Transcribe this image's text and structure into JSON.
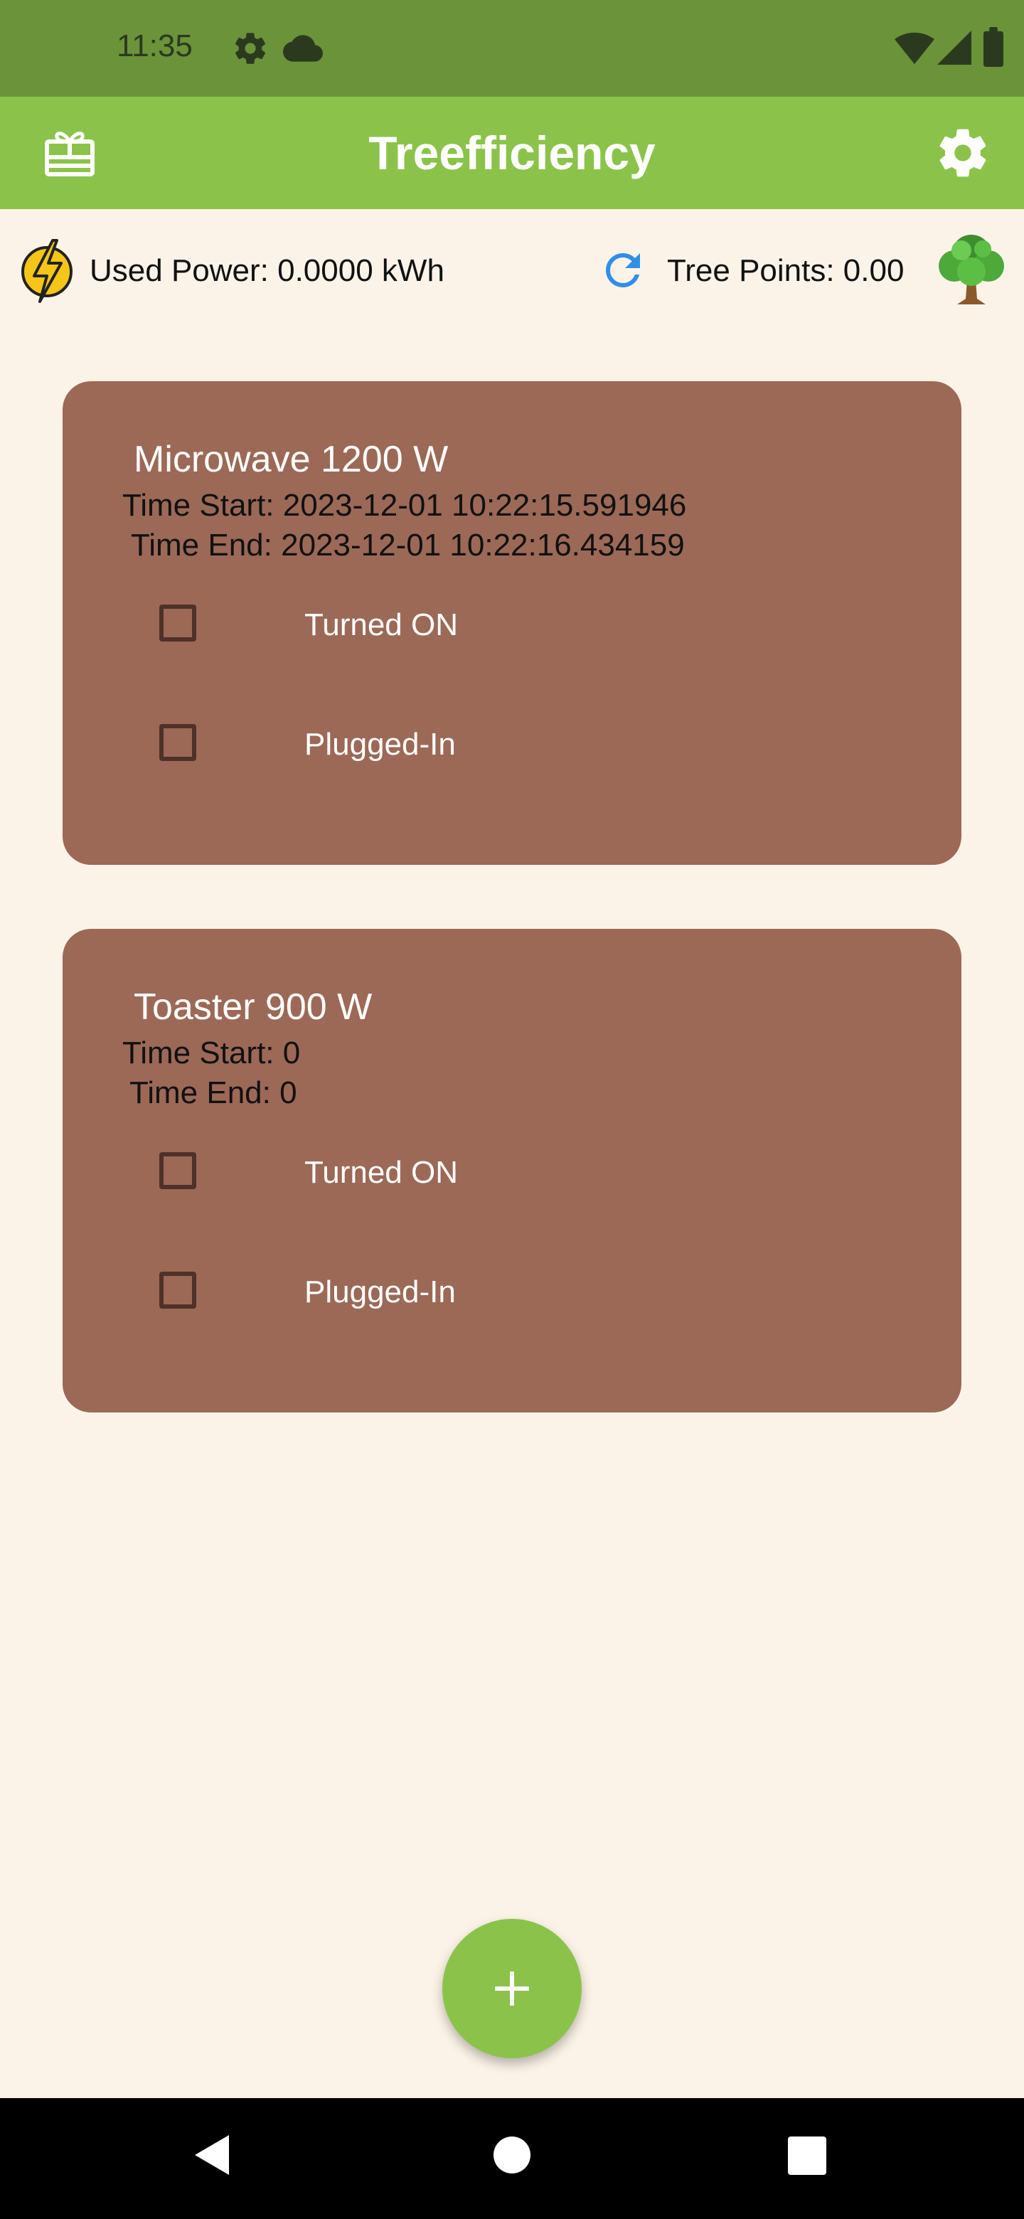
{
  "status_bar": {
    "time": "11:35",
    "icons": [
      "gear-icon",
      "cloud-icon",
      "wifi-icon",
      "signal-icon",
      "battery-icon"
    ]
  },
  "app_bar": {
    "title": "Treefficiency",
    "left_icon": "gift-card-icon",
    "right_icon": "gear-icon"
  },
  "info": {
    "used_power": "Used Power: 0.0000 kWh",
    "tree_points": "Tree Points: 0.00"
  },
  "appliances": [
    {
      "title": "Microwave 1200 W",
      "time_start": "Time Start: 2023-12-01 10:22:15.591946",
      "time_end": "Time End: 2023-12-01 10:22:16.434159",
      "turned_on_label": "Turned ON",
      "turned_on": false,
      "plugged_in_label": "Plugged-In",
      "plugged_in": false
    },
    {
      "title": "Toaster 900 W",
      "time_start": "Time Start: 0",
      "time_end": "Time End: 0",
      "turned_on_label": "Turned ON",
      "turned_on": false,
      "plugged_in_label": "Plugged-In",
      "plugged_in": false
    }
  ],
  "fab": {
    "icon": "plus-icon"
  },
  "nav_bar": {
    "icons": [
      "back-icon",
      "home-icon",
      "recents-icon"
    ]
  },
  "colors": {
    "status_bar": "#6B933A",
    "app_bar": "#8BC34A",
    "background": "#FCF3E8",
    "card": "#9C6957",
    "checkbox_border": "#4E3129",
    "fab": "#8BC34A",
    "refresh_icon": "#2F8FE8",
    "power_icon": "#F5C518"
  }
}
